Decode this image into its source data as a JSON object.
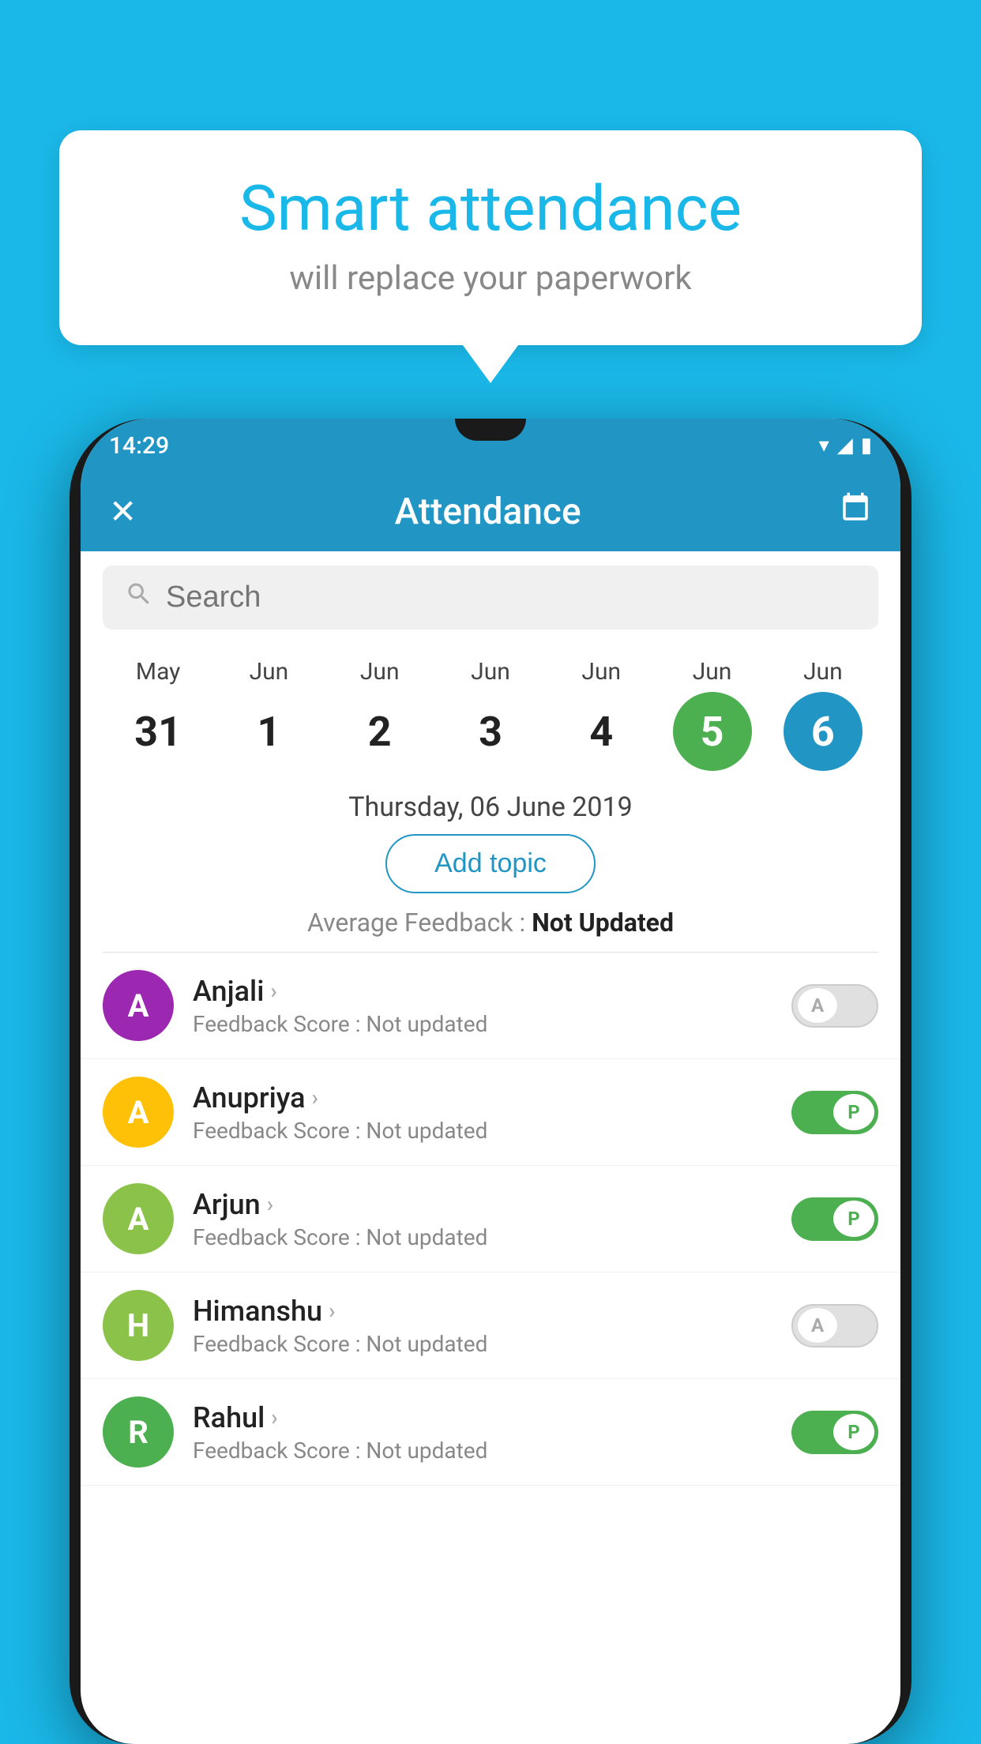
{
  "background_color": "#1ab8e8",
  "bubble": {
    "title": "Smart attendance",
    "subtitle": "will replace your paperwork"
  },
  "status_bar": {
    "time": "14:29",
    "wifi_icon": "▼",
    "signal_icon": "▲",
    "battery_icon": "▮"
  },
  "app_bar": {
    "close_icon": "✕",
    "title": "Attendance",
    "calendar_icon": "📅"
  },
  "search": {
    "placeholder": "Search"
  },
  "calendar": {
    "days": [
      {
        "month": "May",
        "date": "31",
        "style": "normal"
      },
      {
        "month": "Jun",
        "date": "1",
        "style": "normal"
      },
      {
        "month": "Jun",
        "date": "2",
        "style": "normal"
      },
      {
        "month": "Jun",
        "date": "3",
        "style": "normal"
      },
      {
        "month": "Jun",
        "date": "4",
        "style": "normal"
      },
      {
        "month": "Jun",
        "date": "5",
        "style": "green"
      },
      {
        "month": "Jun",
        "date": "6",
        "style": "blue"
      }
    ]
  },
  "selected_date": "Thursday, 06 June 2019",
  "add_topic_label": "Add topic",
  "avg_feedback_label": "Average Feedback :",
  "avg_feedback_value": "Not Updated",
  "students": [
    {
      "name": "Anjali",
      "initial": "A",
      "avatar_color": "#9C27B0",
      "feedback": "Feedback Score : Not updated",
      "toggle": "off",
      "toggle_label": "A"
    },
    {
      "name": "Anupriya",
      "initial": "A",
      "avatar_color": "#FFC107",
      "feedback": "Feedback Score : Not updated",
      "toggle": "on",
      "toggle_label": "P"
    },
    {
      "name": "Arjun",
      "initial": "A",
      "avatar_color": "#8BC34A",
      "feedback": "Feedback Score : Not updated",
      "toggle": "on",
      "toggle_label": "P"
    },
    {
      "name": "Himanshu",
      "initial": "H",
      "avatar_color": "#8BC34A",
      "feedback": "Feedback Score : Not updated",
      "toggle": "off",
      "toggle_label": "A"
    },
    {
      "name": "Rahul",
      "initial": "R",
      "avatar_color": "#4CAF50",
      "feedback": "Feedback Score : Not updated",
      "toggle": "on",
      "toggle_label": "P"
    }
  ]
}
